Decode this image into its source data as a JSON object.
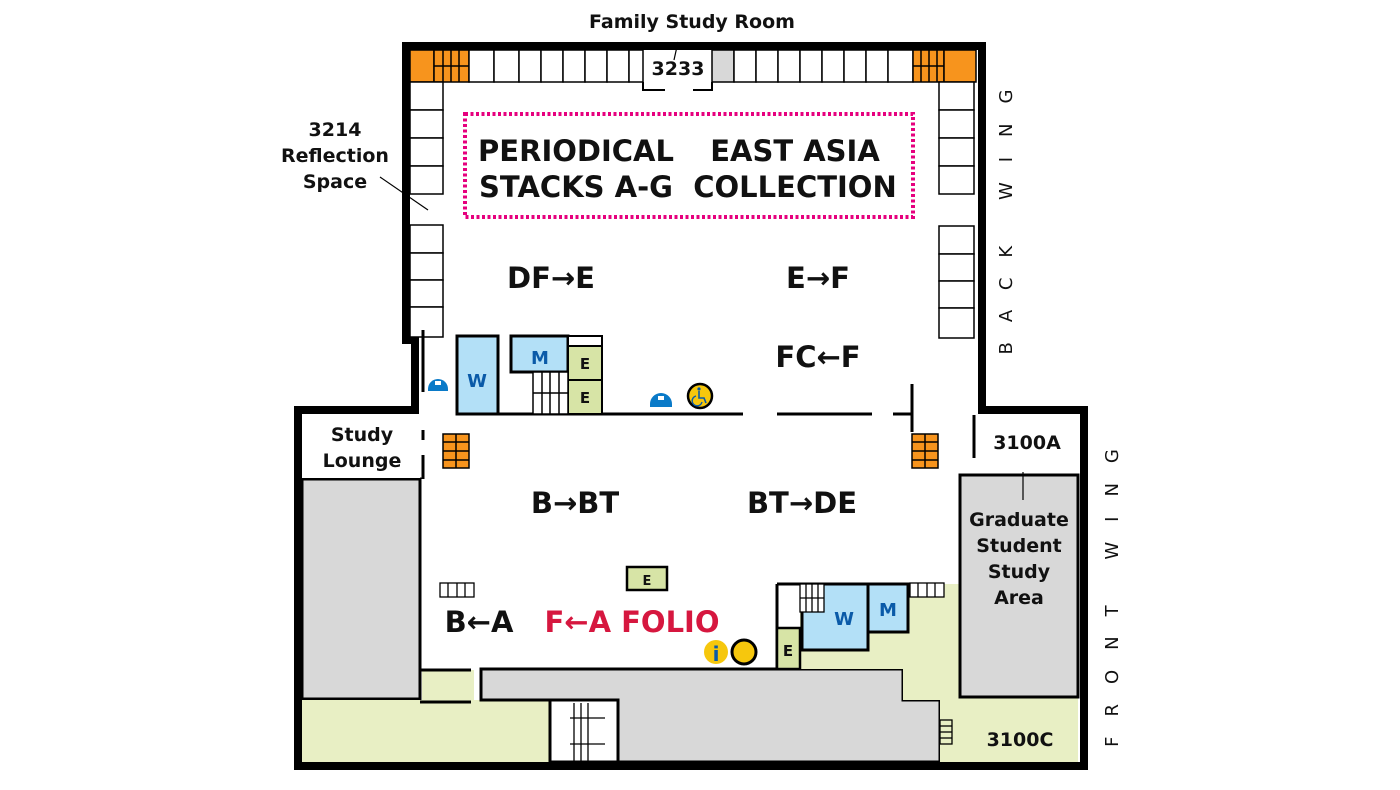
{
  "map": {
    "top_label": "Family Study Room",
    "rooms": {
      "family_study_room_number": "3233",
      "reflection_space": [
        "3214",
        "Reflection",
        "Space"
      ],
      "study_lounge": [
        "Study",
        "Lounge"
      ],
      "room_3100a": "3100A",
      "graduate_study": [
        "Graduate",
        "Student",
        "Study",
        "Area"
      ],
      "room_3100c": "3100C"
    },
    "collections": {
      "periodical": [
        "PERIODICAL",
        "STACKS A-G"
      ],
      "east_asia": [
        "EAST ASIA",
        "COLLECTION"
      ]
    },
    "call_number_ranges": {
      "df_e": "DF→E",
      "e_f": "E→F",
      "fc_f": "FC←F",
      "b_bt": "B→BT",
      "bt_de": "BT→DE",
      "b_a": "B←A",
      "folio": "F←A FOLIO"
    },
    "wings": {
      "back": "BACK WING",
      "front": "FRONT WING"
    },
    "restrooms": {
      "women": "W",
      "men": "M"
    },
    "elevator_label": "E",
    "icons": {
      "info": "i"
    },
    "colors": {
      "wall": "#000000",
      "study_carrel_orange": "#f7941d",
      "restroom_blue": "#b3e0f7",
      "restroom_text": "#0a5aa8",
      "elevator_green": "#d7e4a6",
      "open_area_green": "#e8efc4",
      "closed_area_gray": "#d8d8d8",
      "collection_border": "#e6007e",
      "folio_red": "#d6173f",
      "accessible_yellow": "#f6c70d",
      "lock_blue": "#0a7ac8"
    }
  }
}
